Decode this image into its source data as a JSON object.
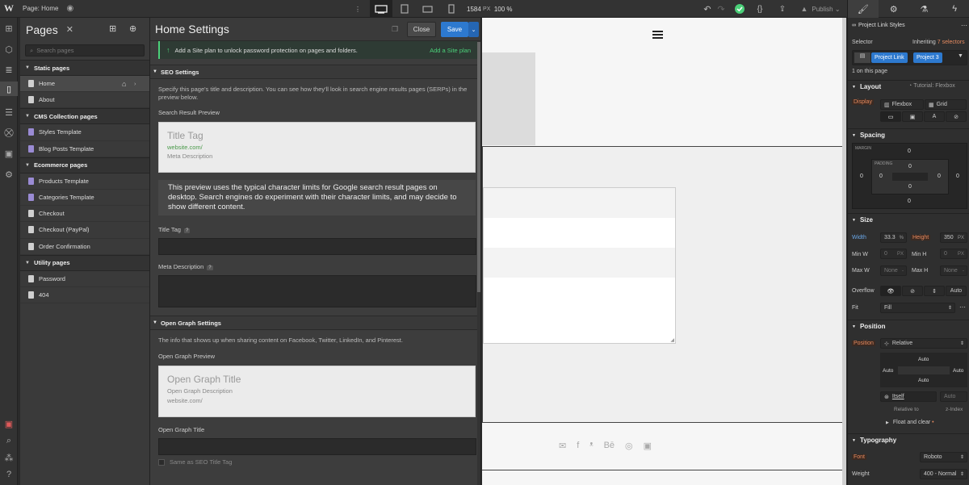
{
  "topbar": {
    "page_label": "Page: Home",
    "width_value": "1584",
    "width_unit": "PX",
    "zoom": "100 %",
    "publish": "Publish"
  },
  "pages_panel": {
    "title": "Pages",
    "search_placeholder": "Search pages",
    "sections": [
      {
        "title": "Static pages",
        "pages": [
          "Home",
          "About"
        ]
      },
      {
        "title": "CMS Collection pages",
        "pages": [
          "Styles Template",
          "Blog Posts Template"
        ]
      },
      {
        "title": "Ecommerce pages",
        "pages": [
          "Products Template",
          "Categories Template",
          "Checkout",
          "Checkout (PayPal)",
          "Order Confirmation"
        ]
      },
      {
        "title": "Utility pages",
        "pages": [
          "Password",
          "404"
        ]
      }
    ]
  },
  "settings": {
    "title": "Home Settings",
    "close": "Close",
    "save": "Save",
    "banner_text": "Add a Site plan to unlock password protection on pages and folders.",
    "banner_link": "Add a Site plan",
    "seo_heading": "SEO Settings",
    "seo_desc": "Specify this page's title and description. You can see how they'll look in search engine results pages (SERPs) in the preview below.",
    "search_preview_label": "Search Result Preview",
    "preview_title": "Title Tag",
    "preview_url": "website.com/",
    "preview_meta": "Meta Description",
    "preview_note": "This preview uses the typical character limits for Google search result pages on desktop. Search engines do experiment with their character limits, and may decide to show different content.",
    "title_tag_label": "Title Tag",
    "meta_desc_label": "Meta Description",
    "og_heading": "Open Graph Settings",
    "og_desc": "The info that shows up when sharing content on Facebook, Twitter, LinkedIn, and Pinterest.",
    "og_preview_label": "Open Graph Preview",
    "og_preview_title": "Open Graph Title",
    "og_preview_desc": "Open Graph Description",
    "og_preview_url": "website.com/",
    "og_title_label": "Open Graph Title",
    "og_same_as": "Same as SEO Title Tag",
    "help": "?"
  },
  "right_panel": {
    "header": "Project Link Styles",
    "selector": "Selector",
    "inheriting": "Inheriting",
    "inheriting_count": "7 selectors",
    "tags": [
      "Project Link",
      "Project 3"
    ],
    "on_page": "1 on this page",
    "layout": "Layout",
    "tutorial": "Tutorial: Flexbox",
    "display": "Display",
    "flexbox": "Flexbox",
    "grid": "Grid",
    "spacing": "Spacing",
    "margin": "MARGIN",
    "padding": "PADDING",
    "zero": "0",
    "size": "Size",
    "width": "Width",
    "width_val": "33.3",
    "width_unit": "%",
    "height": "Height",
    "height_val": "350",
    "height_unit": "PX",
    "min_w": "Min W",
    "min_h": "Min H",
    "max_w": "Max W",
    "max_h": "Max H",
    "none": "None",
    "px": "PX",
    "dash": "-",
    "overflow": "Overflow",
    "auto": "Auto",
    "fit": "Fit",
    "fill": "Fill",
    "position": "Position",
    "position_val": "Relative",
    "itself": "Itself",
    "relative_to": "Relative to",
    "z_index": "z-Index",
    "float_clear": "Float and clear",
    "typography": "Typography",
    "font": "Font",
    "font_val": "Roboto",
    "weight": "Weight",
    "weight_val": "400 - Normal"
  },
  "colors": {
    "accent": "#2d79cf",
    "green": "#4bd079",
    "orange": "#e48a60"
  }
}
